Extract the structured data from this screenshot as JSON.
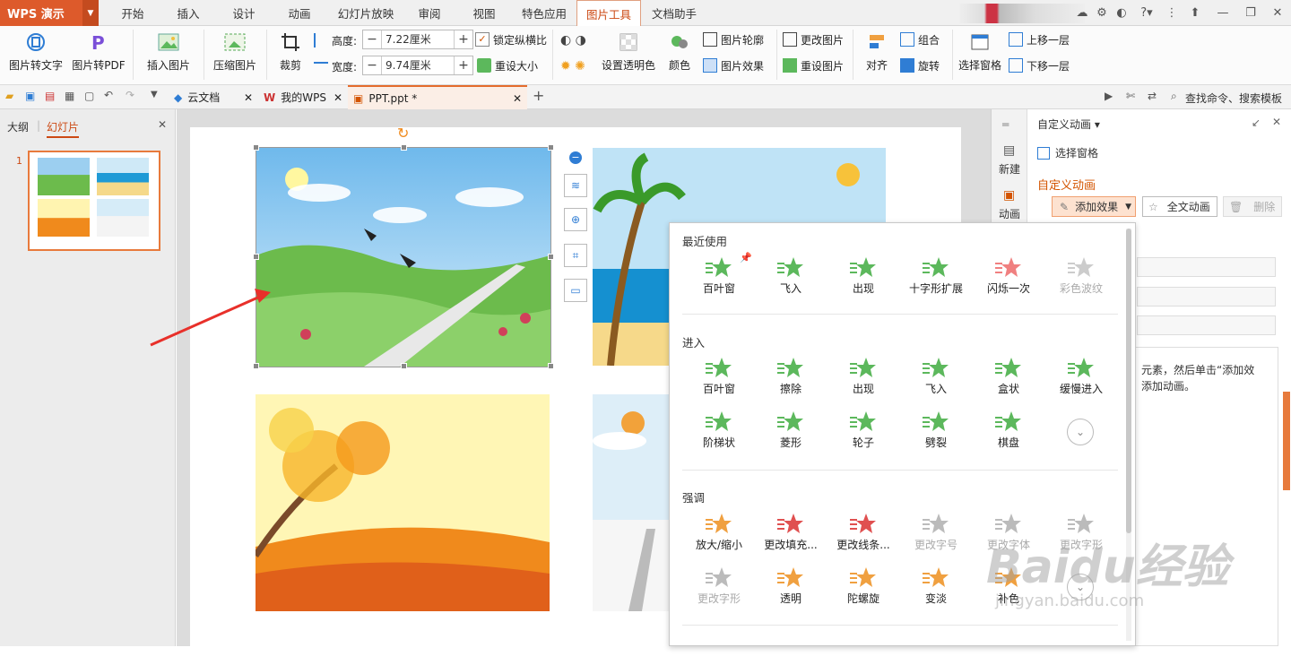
{
  "app": {
    "logo": "WPS 演示"
  },
  "menu_tabs": [
    "开始",
    "插入",
    "设计",
    "动画",
    "幻灯片放映",
    "审阅",
    "视图",
    "特色应用",
    "图片工具",
    "文档助手"
  ],
  "ribbon": {
    "img_to_text": "图片转文字",
    "img_to_pdf": "图片转PDF",
    "insert_image": "插入图片",
    "compress": "压缩图片",
    "crop": "裁剪",
    "height_label": "高度:",
    "height_value": "7.22厘米",
    "width_label": "宽度:",
    "width_value": "9.74厘米",
    "lock_ratio": "锁定纵横比",
    "reset_size": "重设大小",
    "set_transparent": "设置透明色",
    "color": "颜色",
    "img_outline": "图片轮廓",
    "img_effect": "图片效果",
    "change_img": "更改图片",
    "reset_img": "重设图片",
    "align": "对齐",
    "group": "组合",
    "rotate": "旋转",
    "selection_pane": "选择窗格",
    "bring_forward": "上移一层",
    "send_backward": "下移一层"
  },
  "doc_tabs": [
    "云文档",
    "我的WPS",
    "PPT.ppt *"
  ],
  "search_hint": "查找命令、搜索模板",
  "left_panel": {
    "tab_outline": "大纲",
    "tab_slides": "幻灯片",
    "slide_number": "1"
  },
  "right_panel": {
    "header": "自定义动画",
    "strip_new": "新建",
    "strip_anim": "动画",
    "selection_pane": "选择窗格",
    "section_title": "自定义动画",
    "add_effect": "添加效果",
    "full_anim": "全文动画",
    "delete": "删除",
    "hint_line1": "元素，然后单击“添加效",
    "hint_line2": "添加动画。"
  },
  "popup": {
    "recent_title": "最近使用",
    "recent": [
      {
        "label": "百叶窗",
        "color": "#5cb85c"
      },
      {
        "label": "飞入",
        "color": "#5cb85c"
      },
      {
        "label": "出现",
        "color": "#5cb85c"
      },
      {
        "label": "十字形扩展",
        "color": "#5cb85c"
      },
      {
        "label": "闪烁一次",
        "color": "#f08080"
      },
      {
        "label": "彩色波纹",
        "color": "#cccccc"
      }
    ],
    "enter_title": "进入",
    "enter": [
      {
        "label": "百叶窗",
        "color": "#5cb85c"
      },
      {
        "label": "擦除",
        "color": "#5cb85c"
      },
      {
        "label": "出现",
        "color": "#5cb85c"
      },
      {
        "label": "飞入",
        "color": "#5cb85c"
      },
      {
        "label": "盒状",
        "color": "#5cb85c"
      },
      {
        "label": "缓慢进入",
        "color": "#5cb85c"
      },
      {
        "label": "阶梯状",
        "color": "#5cb85c"
      },
      {
        "label": "菱形",
        "color": "#5cb85c"
      },
      {
        "label": "轮子",
        "color": "#5cb85c"
      },
      {
        "label": "劈裂",
        "color": "#5cb85c"
      },
      {
        "label": "棋盘",
        "color": "#5cb85c"
      }
    ],
    "emph_title": "强调",
    "emph": [
      {
        "label": "放大/缩小",
        "color": "#f0a040"
      },
      {
        "label": "更改填充...",
        "color": "#e05050"
      },
      {
        "label": "更改线条...",
        "color": "#e05050"
      },
      {
        "label": "更改字号",
        "color": "#bbbbbb"
      },
      {
        "label": "更改字体",
        "color": "#bbbbbb"
      },
      {
        "label": "更改字形",
        "color": "#bbbbbb"
      },
      {
        "label": "更改字形",
        "color": "#bbbbbb"
      },
      {
        "label": "透明",
        "color": "#f0a040"
      },
      {
        "label": "陀螺旋",
        "color": "#f0a040"
      },
      {
        "label": "变淡",
        "color": "#f0a040"
      },
      {
        "label": "补色",
        "color": "#f0a040"
      }
    ]
  },
  "watermark": {
    "text": "Baidu经验",
    "url": "jingyan.baidu.com"
  }
}
